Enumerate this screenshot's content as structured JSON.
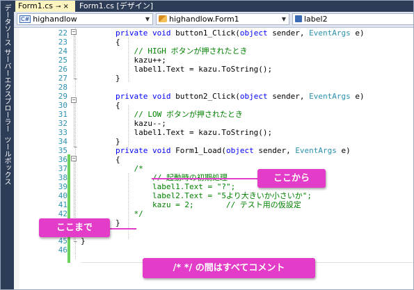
{
  "sidebar": {
    "panels": [
      "データソース",
      "サーバーエクスプローラー",
      "ツールボックス"
    ]
  },
  "tabs": [
    {
      "label": "Form1.cs",
      "pin": "⊸",
      "close": "×",
      "active": true
    },
    {
      "label": "Form1.cs [デザイン]",
      "active": false
    }
  ],
  "navbar": {
    "namespace": "highandlow",
    "class": "highandlow.Form1",
    "member": "label2"
  },
  "editor": {
    "lines": [
      {
        "n": "22",
        "tokens": [
          [
            "kw",
            "private "
          ],
          [
            "kw",
            "void "
          ],
          [
            "",
            "button1_Click("
          ],
          [
            "kw",
            "object "
          ],
          [
            "",
            "sender, "
          ],
          [
            "ty",
            "EventArgs "
          ],
          [
            "",
            "e)"
          ]
        ]
      },
      {
        "n": "23",
        "tokens": [
          [
            "",
            "{"
          ]
        ]
      },
      {
        "n": "24",
        "tokens": [
          [
            "cm",
            "    // HIGH ボタンが押されたとき"
          ]
        ]
      },
      {
        "n": "25",
        "tokens": [
          [
            "",
            "    kazu++;"
          ]
        ]
      },
      {
        "n": "26",
        "tokens": [
          [
            "",
            "    label1.Text = kazu.ToString();"
          ]
        ]
      },
      {
        "n": "27",
        "tokens": [
          [
            "",
            "}"
          ]
        ]
      },
      {
        "n": "28",
        "tokens": []
      },
      {
        "n": "29",
        "tokens": [
          [
            "kw",
            "private "
          ],
          [
            "kw",
            "void "
          ],
          [
            "",
            "button2_Click("
          ],
          [
            "kw",
            "object "
          ],
          [
            "",
            "sender, "
          ],
          [
            "ty",
            "EventArgs "
          ],
          [
            "",
            "e)"
          ]
        ]
      },
      {
        "n": "30",
        "tokens": [
          [
            "",
            "{"
          ]
        ]
      },
      {
        "n": "31",
        "tokens": [
          [
            "cm",
            "    // LOW ボタンが押されたとき"
          ]
        ]
      },
      {
        "n": "32",
        "tokens": [
          [
            "",
            "    kazu--;"
          ]
        ]
      },
      {
        "n": "33",
        "tokens": [
          [
            "",
            "    label1.Text = kazu.ToString();"
          ]
        ]
      },
      {
        "n": "34",
        "tokens": [
          [
            "",
            "}"
          ]
        ]
      },
      {
        "n": "35",
        "tokens": [
          [
            "kw",
            "private "
          ],
          [
            "kw",
            "void "
          ],
          [
            "",
            "Form1_Load("
          ],
          [
            "kw",
            "object "
          ],
          [
            "",
            "sender, "
          ],
          [
            "ty",
            "EventArgs "
          ],
          [
            "",
            "e)"
          ]
        ]
      },
      {
        "n": "36",
        "tokens": [
          [
            "",
            "{"
          ]
        ]
      },
      {
        "n": "37",
        "tokens": [
          [
            "cm",
            "    /*"
          ]
        ]
      },
      {
        "n": "38",
        "tokens": [
          [
            "cm",
            "        // 起動時の初期処理"
          ]
        ]
      },
      {
        "n": "39",
        "tokens": [
          [
            "cm",
            "        label1.Text = \"?\";"
          ]
        ]
      },
      {
        "n": "40",
        "tokens": [
          [
            "cm",
            "        label2.Text = \"5より大きいか小さいか\";"
          ]
        ]
      },
      {
        "n": "41",
        "tokens": [
          [
            "cm",
            "        kazu = 2;       // テスト用の仮設定"
          ]
        ]
      },
      {
        "n": "42",
        "tokens": [
          [
            "cm",
            "    */"
          ]
        ]
      },
      {
        "n": "43",
        "tokens": [
          [
            "",
            "}"
          ]
        ]
      },
      {
        "n": "44",
        "tokens": [
          [
            "",
            "}"
          ]
        ]
      },
      {
        "n": "45",
        "tokens": [
          [
            "",
            "}"
          ]
        ]
      },
      {
        "n": "46",
        "tokens": []
      }
    ]
  },
  "callouts": {
    "from": "ここから",
    "to": "ここまで",
    "note": "/*  */ の間はすべてコメント"
  },
  "colors": {
    "keyword": "#0000ff",
    "type": "#2b91af",
    "comment": "#008000",
    "callout": "#e23cc8",
    "changebar": "#6cd05a"
  }
}
